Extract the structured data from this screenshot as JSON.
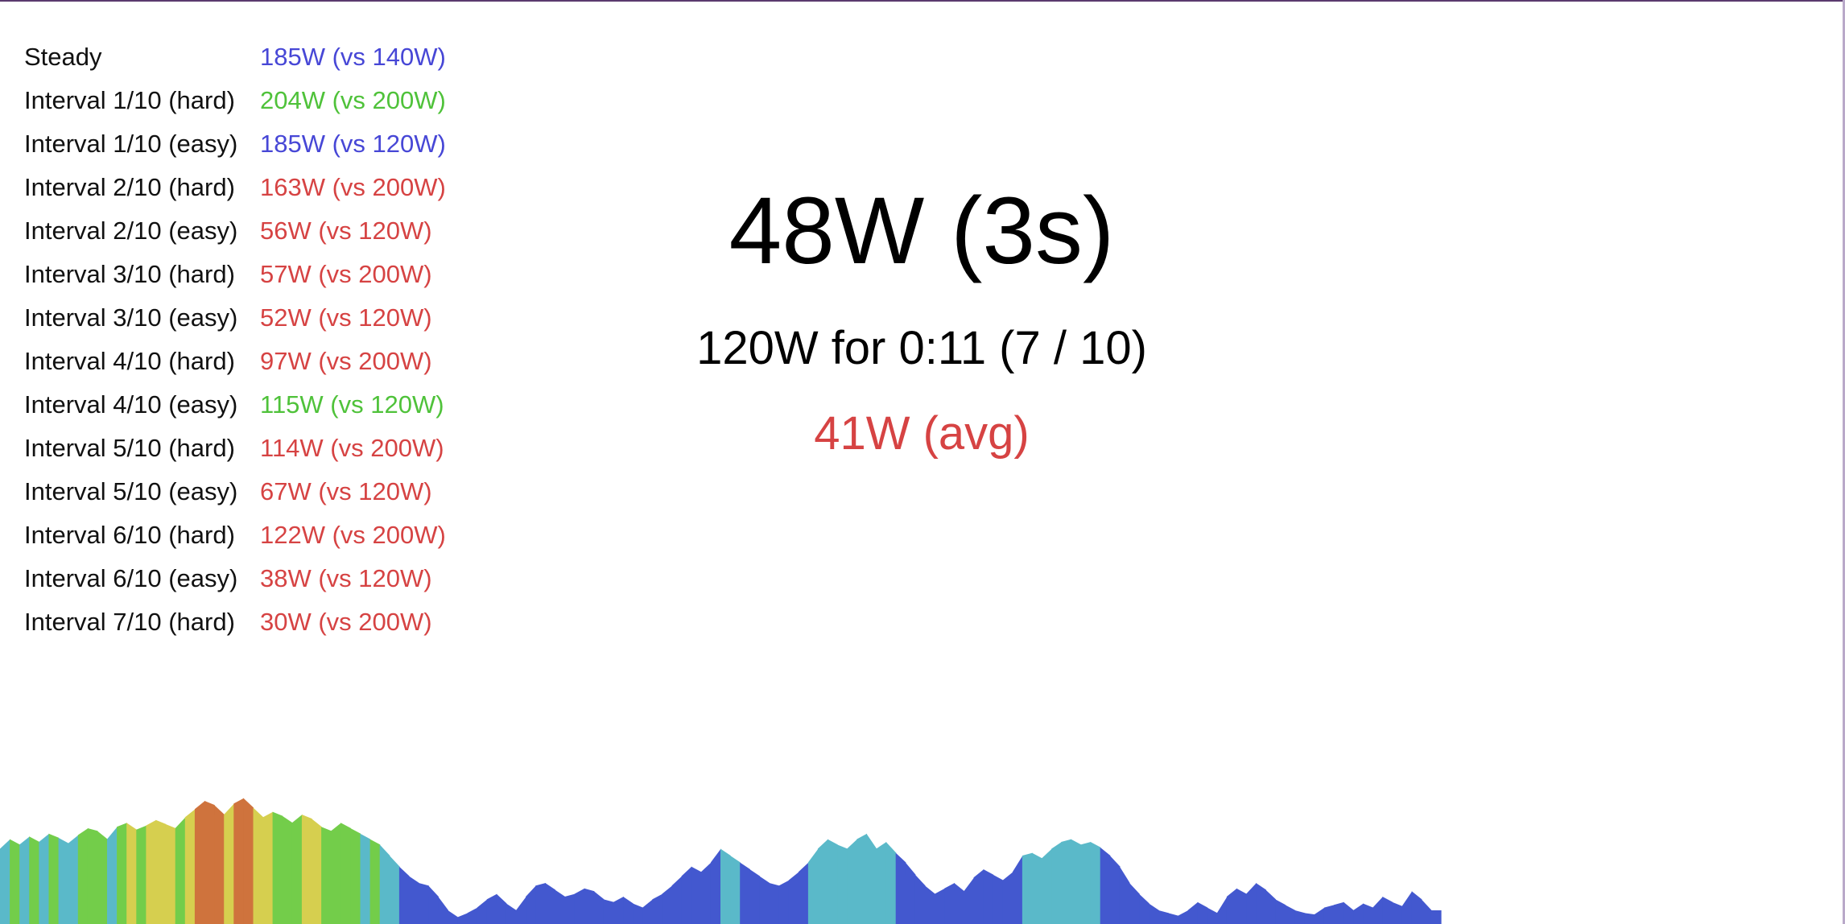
{
  "intervals": [
    {
      "label": "Steady",
      "value": "185W (vs 140W)",
      "status": "blue"
    },
    {
      "label": "Interval 1/10 (hard)",
      "value": "204W (vs 200W)",
      "status": "green"
    },
    {
      "label": "Interval 1/10 (easy)",
      "value": "185W (vs 120W)",
      "status": "blue"
    },
    {
      "label": "Interval 2/10 (hard)",
      "value": "163W (vs 200W)",
      "status": "red"
    },
    {
      "label": "Interval 2/10 (easy)",
      "value": "56W (vs 120W)",
      "status": "red"
    },
    {
      "label": "Interval 3/10 (hard)",
      "value": "57W (vs 200W)",
      "status": "red"
    },
    {
      "label": "Interval 3/10 (easy)",
      "value": "52W (vs 120W)",
      "status": "red"
    },
    {
      "label": "Interval 4/10 (hard)",
      "value": "97W (vs 200W)",
      "status": "red"
    },
    {
      "label": "Interval 4/10 (easy)",
      "value": "115W (vs 120W)",
      "status": "green"
    },
    {
      "label": "Interval 5/10 (hard)",
      "value": "114W (vs 200W)",
      "status": "red"
    },
    {
      "label": "Interval 5/10 (easy)",
      "value": "67W (vs 120W)",
      "status": "red"
    },
    {
      "label": "Interval 6/10 (hard)",
      "value": "122W (vs 200W)",
      "status": "red"
    },
    {
      "label": "Interval 6/10 (easy)",
      "value": "38W (vs 120W)",
      "status": "red"
    },
    {
      "label": "Interval 7/10 (hard)",
      "value": "30W (vs 200W)",
      "status": "red"
    }
  ],
  "stats": {
    "current_power": "48W (3s)",
    "target_info": "120W for 0:11 (7 / 10)",
    "avg_power": "41W (avg)",
    "avg_color": "#d64343"
  },
  "colors": {
    "blue": "#4747d6",
    "green": "#4fc23a",
    "red": "#d64343"
  },
  "chart_data": {
    "type": "area",
    "zone_colors": {
      "z1": "#4358cf",
      "z2": "#5ab9c9",
      "z3": "#73cd4a",
      "z4": "#d6cf4f",
      "z5": "#cf733d"
    },
    "values": [
      0.55,
      0.62,
      0.58,
      0.64,
      0.6,
      0.66,
      0.63,
      0.59,
      0.65,
      0.7,
      0.68,
      0.62,
      0.71,
      0.74,
      0.69,
      0.72,
      0.76,
      0.73,
      0.7,
      0.78,
      0.84,
      0.9,
      0.87,
      0.8,
      0.88,
      0.92,
      0.85,
      0.78,
      0.82,
      0.79,
      0.74,
      0.8,
      0.77,
      0.71,
      0.68,
      0.74,
      0.7,
      0.66,
      0.62,
      0.58,
      0.5,
      0.42,
      0.35,
      0.3,
      0.28,
      0.2,
      0.1,
      0.05,
      0.08,
      0.12,
      0.18,
      0.22,
      0.15,
      0.1,
      0.2,
      0.28,
      0.3,
      0.25,
      0.2,
      0.22,
      0.26,
      0.24,
      0.18,
      0.16,
      0.2,
      0.15,
      0.12,
      0.18,
      0.22,
      0.28,
      0.35,
      0.42,
      0.38,
      0.45,
      0.55,
      0.5,
      0.45,
      0.4,
      0.35,
      0.3,
      0.28,
      0.32,
      0.38,
      0.45,
      0.55,
      0.62,
      0.58,
      0.55,
      0.62,
      0.66,
      0.55,
      0.6,
      0.52,
      0.45,
      0.36,
      0.28,
      0.22,
      0.26,
      0.3,
      0.24,
      0.34,
      0.4,
      0.36,
      0.32,
      0.38,
      0.5,
      0.52,
      0.48,
      0.55,
      0.6,
      0.62,
      0.58,
      0.6,
      0.56,
      0.5,
      0.42,
      0.3,
      0.22,
      0.15,
      0.1,
      0.08,
      0.06,
      0.1,
      0.16,
      0.12,
      0.08,
      0.2,
      0.26,
      0.22,
      0.3,
      0.25,
      0.18,
      0.14,
      0.1,
      0.08,
      0.07,
      0.12,
      0.14,
      0.16,
      0.1,
      0.15,
      0.12,
      0.2,
      0.16,
      0.13,
      0.24,
      0.18,
      0.1
    ],
    "zones": [
      "z2",
      "z3",
      "z2",
      "z3",
      "z2",
      "z3",
      "z2",
      "z2",
      "z3",
      "z3",
      "z3",
      "z2",
      "z3",
      "z4",
      "z3",
      "z4",
      "z4",
      "z4",
      "z3",
      "z4",
      "z5",
      "z5",
      "z5",
      "z4",
      "z5",
      "z5",
      "z4",
      "z4",
      "z3",
      "z3",
      "z3",
      "z4",
      "z4",
      "z3",
      "z3",
      "z3",
      "z3",
      "z2",
      "z3",
      "z2",
      "z2",
      "z1",
      "z1",
      "z1",
      "z1",
      "z1",
      "z1",
      "z1",
      "z1",
      "z1",
      "z1",
      "z1",
      "z1",
      "z1",
      "z1",
      "z1",
      "z1",
      "z1",
      "z1",
      "z1",
      "z1",
      "z1",
      "z1",
      "z1",
      "z1",
      "z1",
      "z1",
      "z1",
      "z1",
      "z1",
      "z1",
      "z1",
      "z1",
      "z1",
      "z2",
      "z2",
      "z1",
      "z1",
      "z1",
      "z1",
      "z1",
      "z1",
      "z1",
      "z2",
      "z2",
      "z2",
      "z2",
      "z2",
      "z2",
      "z2",
      "z2",
      "z2",
      "z1",
      "z1",
      "z1",
      "z1",
      "z1",
      "z1",
      "z1",
      "z1",
      "z1",
      "z1",
      "z1",
      "z1",
      "z1",
      "z2",
      "z2",
      "z2",
      "z2",
      "z2",
      "z2",
      "z2",
      "z2",
      "z1",
      "z1",
      "z1",
      "z1",
      "z1",
      "z1",
      "z1",
      "z1",
      "z1",
      "z1",
      "z1",
      "z1",
      "z1",
      "z1",
      "z1",
      "z1",
      "z1",
      "z1",
      "z1",
      "z1",
      "z1",
      "z1",
      "z1",
      "z1",
      "z1",
      "z1",
      "z1",
      "z1",
      "z1",
      "z1",
      "z1",
      "z1",
      "z1",
      "z1",
      "z1"
    ],
    "ylim": [
      0,
      1
    ]
  }
}
